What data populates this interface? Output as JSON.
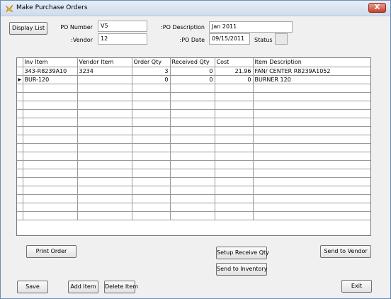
{
  "window": {
    "title": "Make Purchase Orders",
    "close_label": "X"
  },
  "header": {
    "display_list_label": "Display List",
    "po_number_label": "PO Number",
    "po_number_value": "V5",
    "vendor_label": ":Vendor",
    "vendor_value": "12",
    "po_description_label": ":PO Description",
    "po_description_value": "Jan 2011",
    "po_date_label": ":PO Date",
    "po_date_value": "09/15/2011",
    "status_label": "Status"
  },
  "grid": {
    "columns": [
      "Inv Item",
      "Vendor Item",
      "Order Qty",
      "Received Qty",
      "Cost",
      "Item Description"
    ],
    "rows": [
      {
        "indicator": "",
        "inv_item": "343-R8239A10",
        "vendor_item": "3234",
        "order_qty": "3",
        "received_qty": "0",
        "cost": "21.96",
        "description": "FAN/ CENTER R8239A1052"
      },
      {
        "indicator": "▶",
        "inv_item": "BUR-120",
        "vendor_item": "",
        "order_qty": "0",
        "received_qty": "0",
        "cost": "0",
        "description": "BURNER 120"
      }
    ],
    "empty_rows": 16
  },
  "buttons": {
    "print_order": "Print Order",
    "setup_receive_qty": "Setup Receive Qty",
    "send_to_vendor": "Send to Vendor",
    "send_to_inventory": "Send to Inventory",
    "save": "Save",
    "add_item": "Add Item",
    "delete_item": "Delete Item",
    "exit": "Exit"
  }
}
